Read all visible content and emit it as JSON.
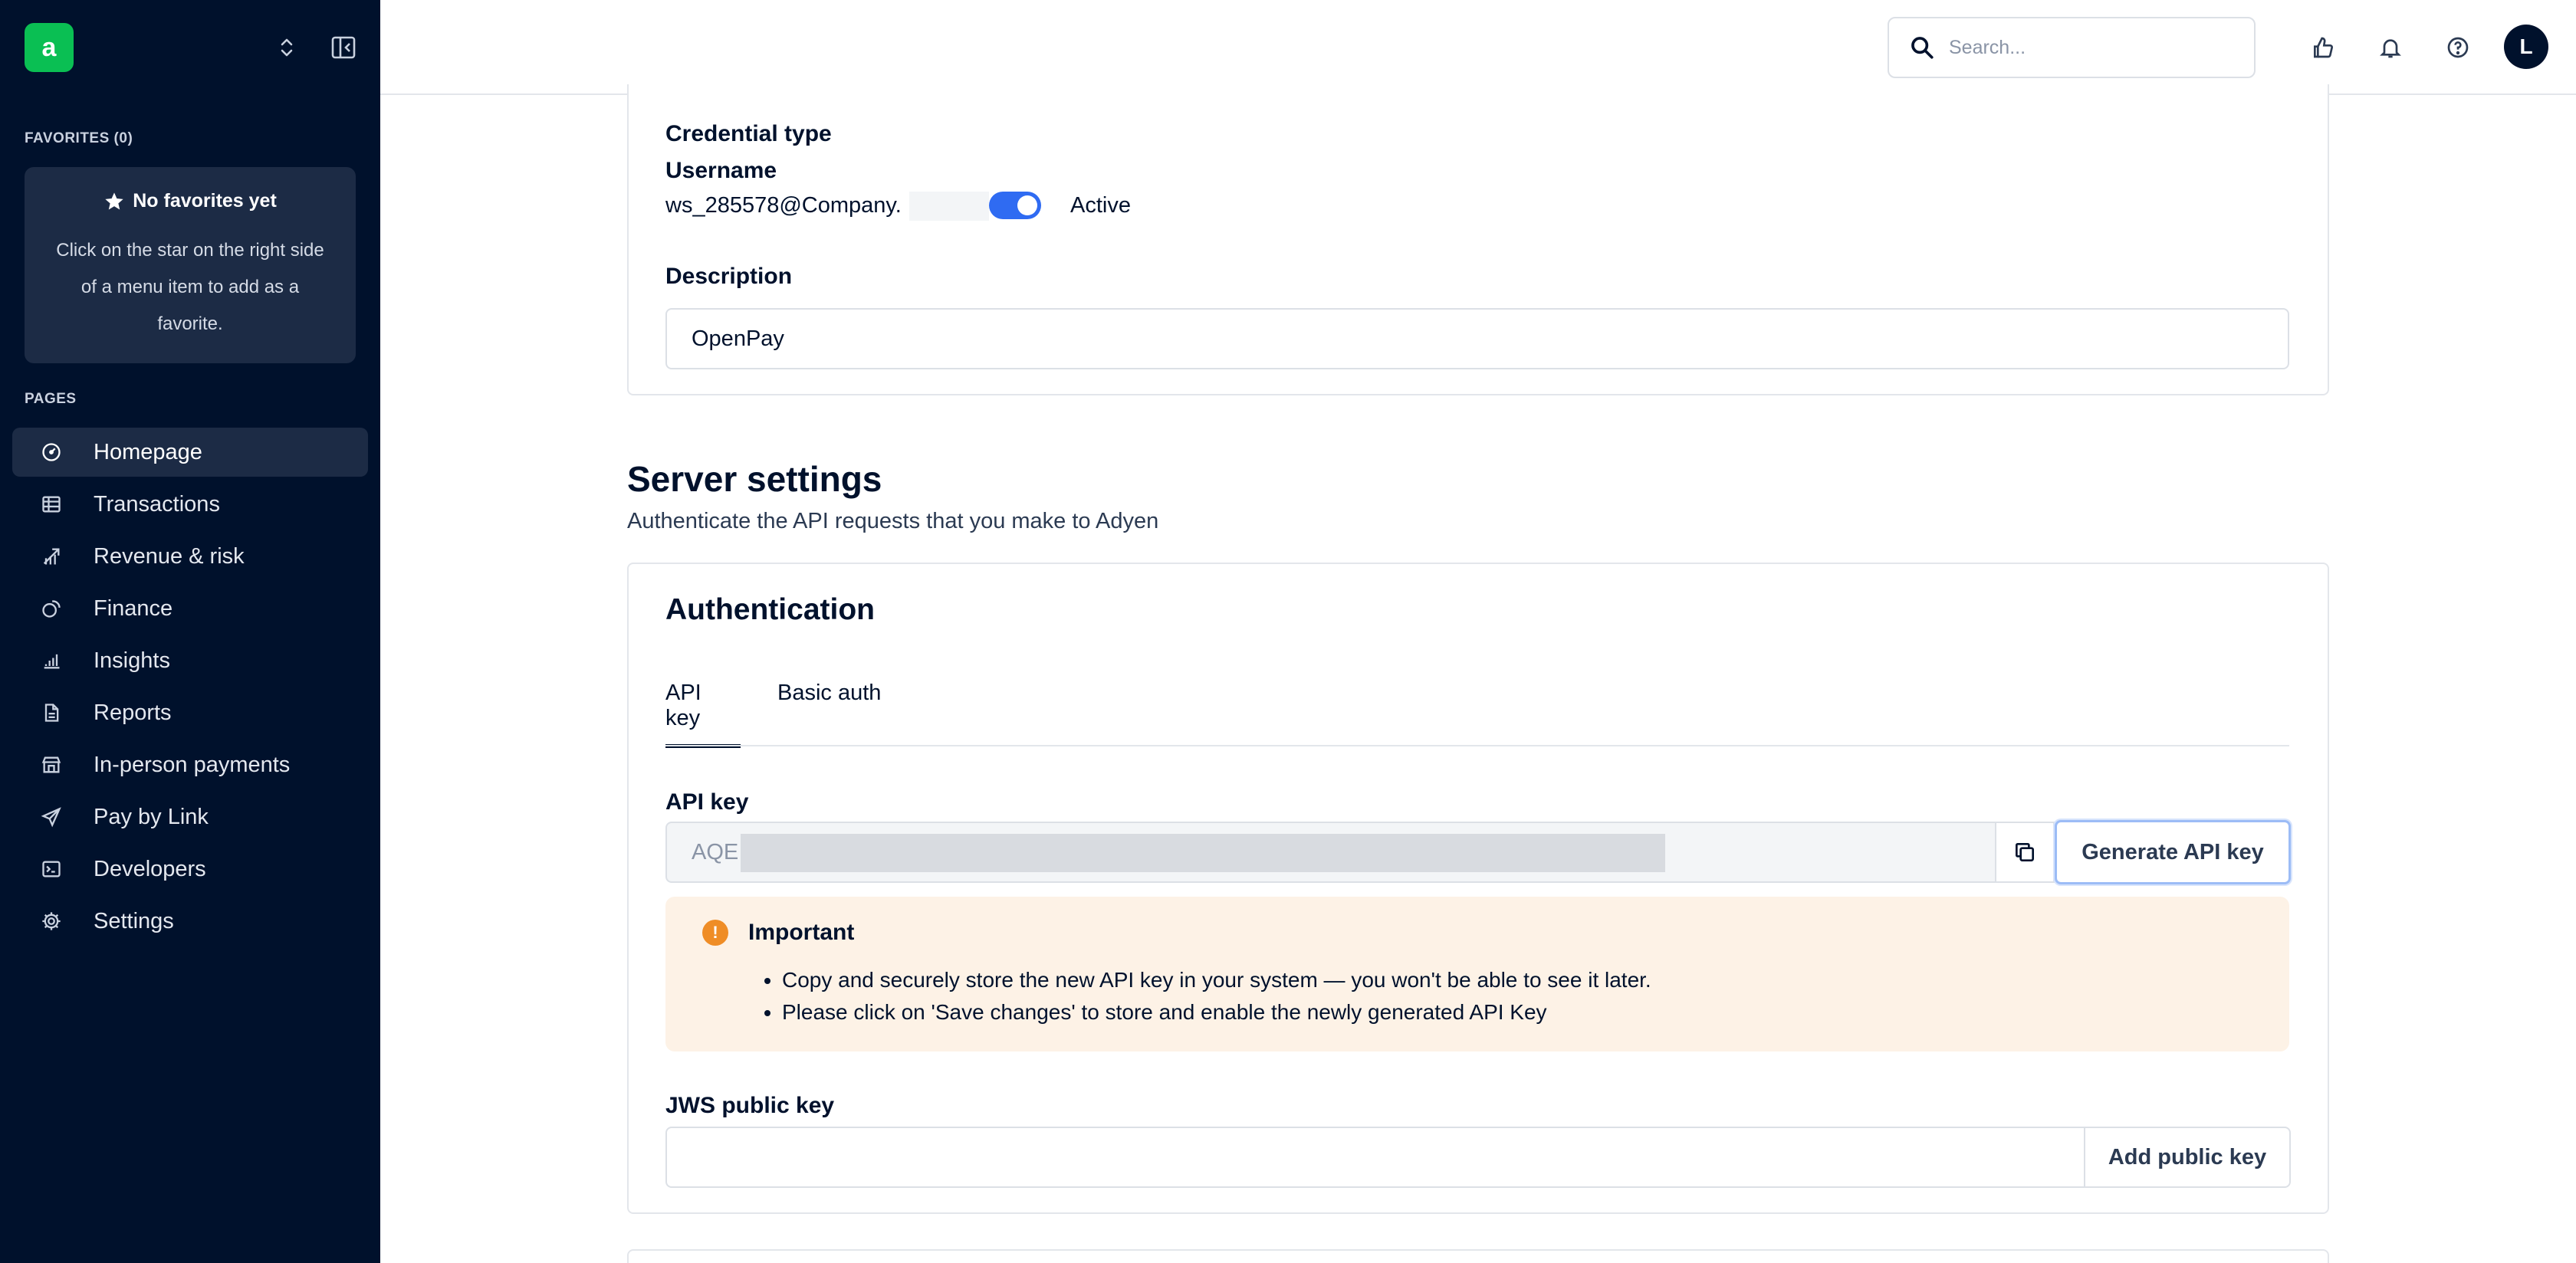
{
  "app": {
    "logo_letter": "a",
    "brand_color": "#0abf53"
  },
  "sidebar": {
    "favorites_heading": "FAVORITES (0)",
    "favorites_empty_title": "No favorites yet",
    "favorites_empty_text": "Click on the star on the right side of a menu item to add as a favorite.",
    "pages_heading": "PAGES",
    "items": [
      {
        "label": "Homepage",
        "icon": "dashboard-gauge-icon",
        "active": true
      },
      {
        "label": "Transactions",
        "icon": "table-icon",
        "active": false
      },
      {
        "label": "Revenue & risk",
        "icon": "revenue-risk-icon",
        "active": false
      },
      {
        "label": "Finance",
        "icon": "coins-icon",
        "active": false
      },
      {
        "label": "Insights",
        "icon": "bar-chart-icon",
        "active": false
      },
      {
        "label": "Reports",
        "icon": "document-icon",
        "active": false
      },
      {
        "label": "In-person payments",
        "icon": "store-icon",
        "active": false
      },
      {
        "label": "Pay by Link",
        "icon": "paper-plane-icon",
        "active": false
      },
      {
        "label": "Developers",
        "icon": "terminal-icon",
        "active": false
      },
      {
        "label": "Settings",
        "icon": "gear-icon",
        "active": false
      }
    ]
  },
  "topbar": {
    "search_placeholder": "Search...",
    "avatar_initial": "L"
  },
  "credential": {
    "type_label": "Credential type",
    "username_label": "Username",
    "username_value": "ws_285578@Company.",
    "status_label": "Active",
    "active": true,
    "description_label": "Description",
    "description_value": "OpenPay"
  },
  "server_settings": {
    "title": "Server settings",
    "subtitle": "Authenticate the API requests that you make to Adyen"
  },
  "authentication": {
    "title": "Authentication",
    "tabs": [
      {
        "label": "API key",
        "active": true
      },
      {
        "label": "Basic auth",
        "active": false
      }
    ],
    "api_key_label": "API key",
    "api_key_prefix": "AQE",
    "generate_button": "Generate API key",
    "alert": {
      "title": "Important",
      "items": [
        "Copy and securely store the new API key in your system — you won't be able to see it later.",
        "Please click on 'Save changes' to store and enable the newly generated API Key"
      ]
    },
    "jws_label": "JWS public key",
    "jws_value": "",
    "add_public_key_button": "Add public key"
  },
  "colors": {
    "sidebar_bg": "#00112c",
    "accent_blue": "#2f6bf2",
    "warning_bg": "#fdf2e6",
    "warning_icon": "#ef8d26"
  }
}
